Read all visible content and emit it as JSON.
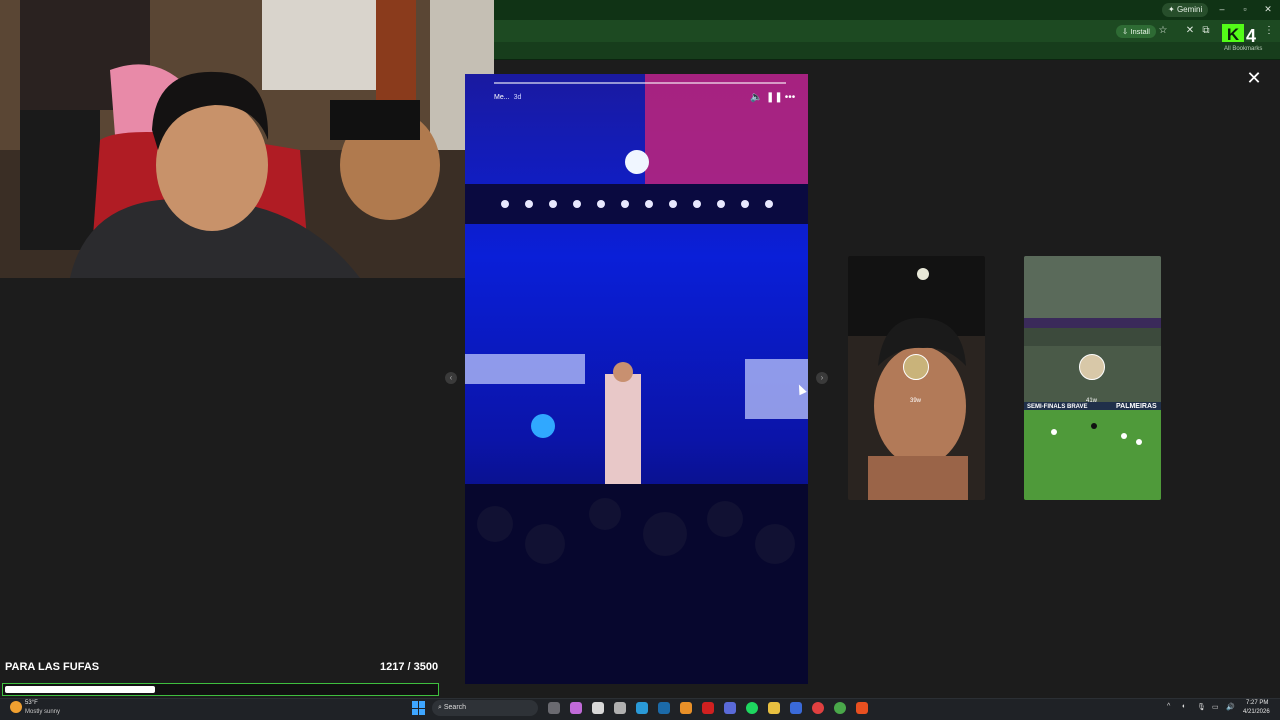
{
  "browser": {
    "gemini_label": "Gemini",
    "install_label": "Install",
    "kick_badge": "4",
    "bookmarks_label": "All Bookmarks"
  },
  "story": {
    "username": "Me...",
    "age": "3d",
    "thumb1_age": "39w",
    "thumb2_age": "41w",
    "thumb2_banner_left": "SEMI-FINALS BRAVE",
    "thumb2_banner_right": "PALMEIRAS"
  },
  "goal": {
    "title": "PARA LAS FUFAS",
    "count": "1217 / 3500",
    "progress": 0.348
  },
  "taskbar": {
    "temperature": "53°F",
    "weather": "Mostly sunny",
    "search_placeholder": "Search",
    "time": "7:27 PM",
    "date": "4/21/2026"
  },
  "colors": {
    "kick_green": "#53fc18",
    "chrome_green": "#1d4a22",
    "goal_border": "#3fbf3f",
    "taskbar_bg": "#1f2226"
  }
}
